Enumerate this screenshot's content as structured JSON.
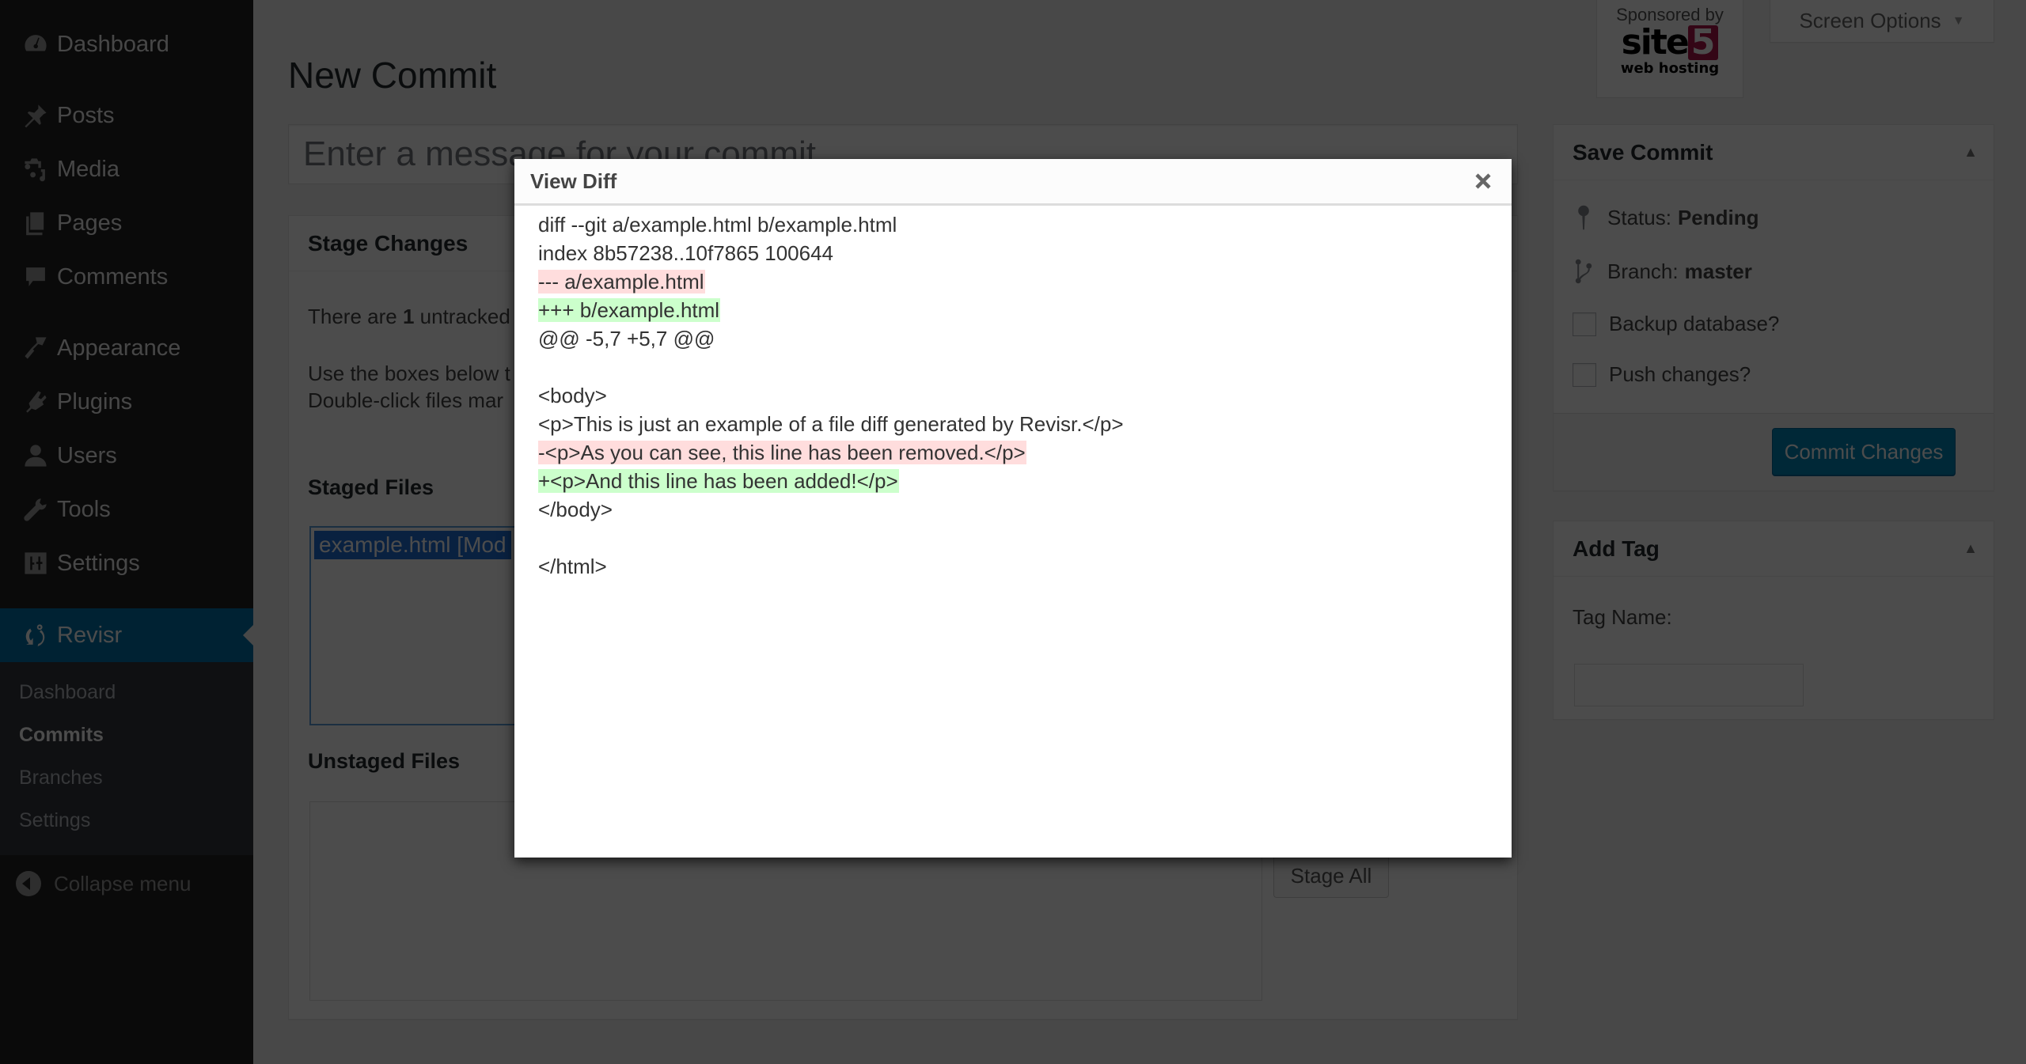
{
  "sidebar": {
    "items": [
      {
        "label": "Dashboard",
        "icon": "dashboard-icon"
      },
      {
        "label": "Posts",
        "icon": "pin-icon"
      },
      {
        "label": "Media",
        "icon": "media-icon"
      },
      {
        "label": "Pages",
        "icon": "pages-icon"
      },
      {
        "label": "Comments",
        "icon": "comment-icon"
      },
      {
        "label": "Appearance",
        "icon": "paintbrush-icon"
      },
      {
        "label": "Plugins",
        "icon": "plugin-icon"
      },
      {
        "label": "Users",
        "icon": "user-icon"
      },
      {
        "label": "Tools",
        "icon": "wrench-icon"
      },
      {
        "label": "Settings",
        "icon": "settings-icon"
      },
      {
        "label": "Revisr",
        "icon": "revisr-icon",
        "active": true
      }
    ],
    "submenu": [
      {
        "label": "Dashboard"
      },
      {
        "label": "Commits",
        "current": true
      },
      {
        "label": "Branches"
      },
      {
        "label": "Settings"
      }
    ],
    "collapse_label": "Collapse menu"
  },
  "header": {
    "sponsor_by": "Sponsored by",
    "sponsor_logo_text": "site",
    "sponsor_logo_num": "5",
    "sponsor_sub": "web hosting",
    "screen_options": "Screen Options"
  },
  "page": {
    "title": "New Commit",
    "message_placeholder": "Enter a message for your commit"
  },
  "stage_changes": {
    "title": "Stage Changes",
    "untracked_prefix": "There are ",
    "untracked_count": "1",
    "untracked_suffix": " untracked",
    "instructions_line1": "Use the boxes below t",
    "instructions_line2": "Double-click files mar",
    "staged_heading": "Staged Files",
    "staged_files": [
      "example.html [Mod"
    ],
    "unstaged_heading": "Unstaged Files",
    "stage_all_label": "Stage All"
  },
  "save_commit": {
    "title": "Save Commit",
    "status_label": "Status:",
    "status_value": "Pending",
    "branch_label": "Branch:",
    "branch_value": "master",
    "backup_label": "Backup database?",
    "push_label": "Push changes?",
    "commit_button": "Commit Changes"
  },
  "add_tag": {
    "title": "Add Tag",
    "tag_name_label": "Tag Name:",
    "tag_name_value": ""
  },
  "modal": {
    "title": "View Diff",
    "diff_lines": [
      {
        "text": "diff --git a/example.html b/example.html",
        "type": "context"
      },
      {
        "text": "index 8b57238..10f7865 100644",
        "type": "context"
      },
      {
        "text": "--- a/example.html",
        "type": "removed"
      },
      {
        "text": "+++ b/example.html",
        "type": "added"
      },
      {
        "text": "@@ -5,7 +5,7 @@",
        "type": "context"
      },
      {
        "text": "",
        "type": "context"
      },
      {
        "text": "<body>",
        "type": "context"
      },
      {
        "text": "<p>This is just an example of a file diff generated by Revisr.</p>",
        "type": "context"
      },
      {
        "text": "-<p>As you can see, this line has been removed.</p>",
        "type": "removed"
      },
      {
        "text": "+<p>And this line has been added!</p>",
        "type": "added"
      },
      {
        "text": "</body>",
        "type": "context"
      },
      {
        "text": "",
        "type": "context"
      },
      {
        "text": "</html>",
        "type": "context"
      }
    ]
  },
  "colors": {
    "accent": "#0073aa",
    "primary_button": "#0085ba",
    "diff_removed_bg": "#ffdddd",
    "diff_added_bg": "#ccffcc"
  }
}
